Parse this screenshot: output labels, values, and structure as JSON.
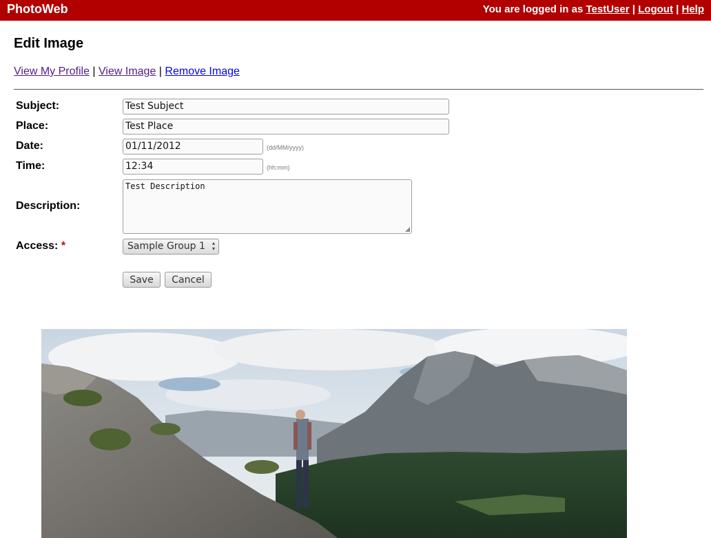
{
  "app": {
    "brand": "PhotoWeb",
    "user_prefix": "You are logged in as",
    "username": "TestUser",
    "separator": "|",
    "logout": "Logout",
    "help": "Help"
  },
  "page": {
    "title": "Edit Image",
    "links": {
      "view_profile": "View My Profile",
      "view_image": "View Image",
      "remove_image": "Remove Image",
      "separator": "|"
    }
  },
  "form": {
    "subject_label": "Subject:",
    "subject_value": "Test Subject",
    "place_label": "Place:",
    "place_value": "Test Place",
    "date_label": "Date:",
    "date_value": "01/11/2012",
    "date_hint": "(dd/MM/yyyy)",
    "time_label": "Time:",
    "time_value": "12:34",
    "time_hint": "(hh:mm)",
    "description_label": "Description:",
    "description_value": "Test Description",
    "access_label": "Access:",
    "access_required_mark": "*",
    "access_selected": "Sample Group 1",
    "save_label": "Save",
    "cancel_label": "Cancel"
  },
  "colors": {
    "brand_bar": "#b20000",
    "required_mark": "#cc0000"
  },
  "icons": {
    "select_arrows": "up-down-chevron-icon",
    "resize": "resize-handle-icon"
  }
}
